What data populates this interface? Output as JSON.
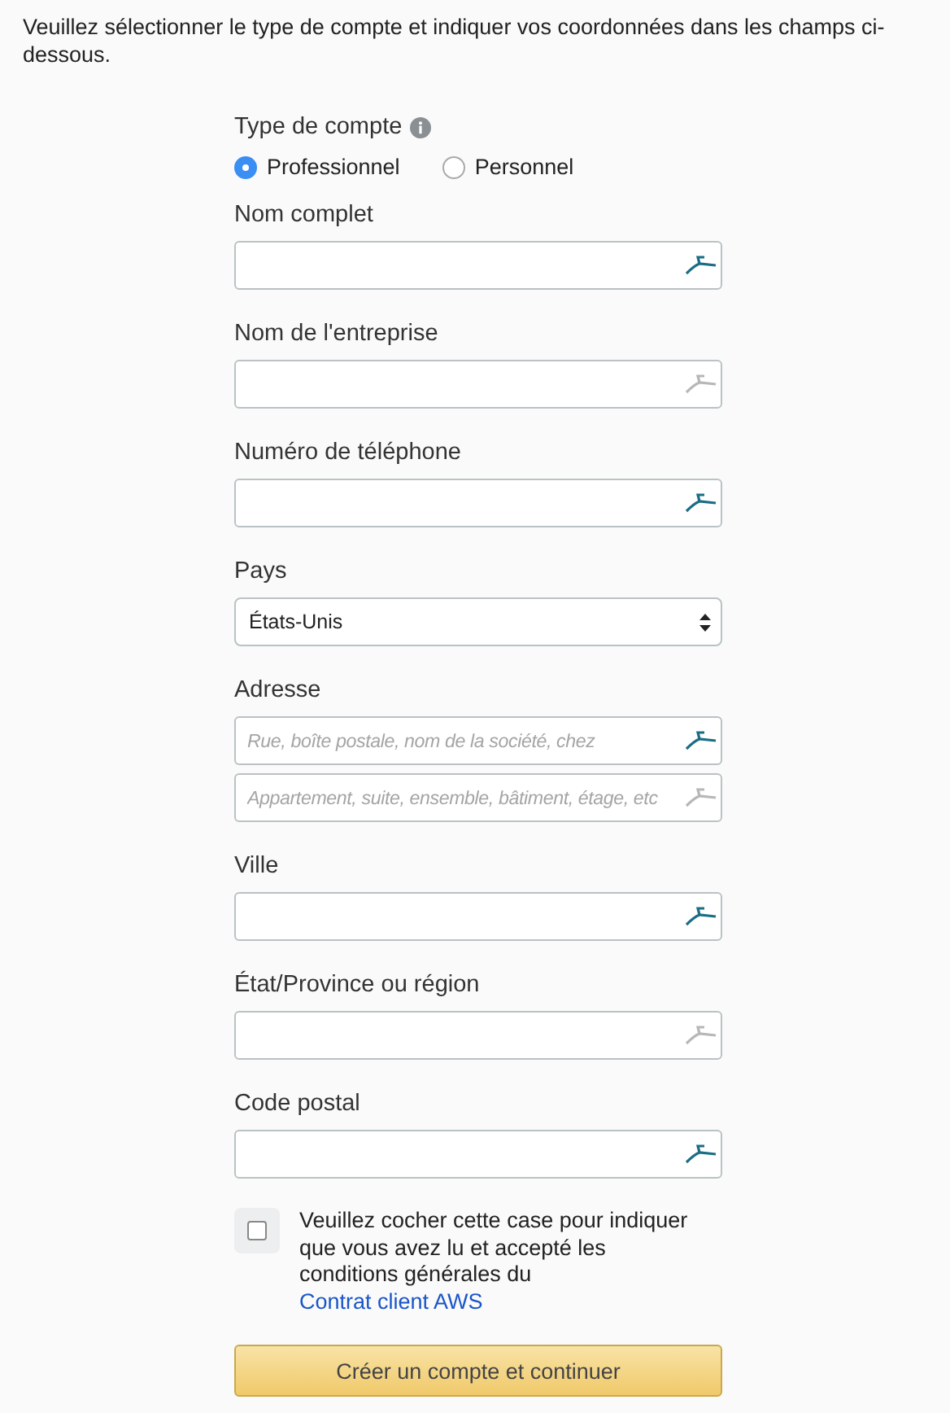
{
  "intro": "Veuillez sélectionner le type de compte et indiquer vos coordonnées dans les champs ci-dessous.",
  "account_type": {
    "label": "Type de compte",
    "options": [
      {
        "label": "Professionnel",
        "selected": true
      },
      {
        "label": "Personnel",
        "selected": false
      }
    ]
  },
  "fields": [
    {
      "kind": "text",
      "label": "Nom complet",
      "inputs": [
        {
          "icon_active": true
        }
      ]
    },
    {
      "kind": "text",
      "label": "Nom de l'entreprise",
      "inputs": [
        {
          "icon_active": false
        }
      ]
    },
    {
      "kind": "text",
      "label": "Numéro de téléphone",
      "inputs": [
        {
          "icon_active": true
        }
      ]
    },
    {
      "kind": "select",
      "label": "Pays",
      "value": "États-Unis"
    },
    {
      "kind": "text",
      "label": "Adresse",
      "inputs": [
        {
          "placeholder": "Rue, boîte postale, nom de la société, chez",
          "icon_active": true
        },
        {
          "placeholder": "Appartement, suite, ensemble, bâtiment, étage, etc",
          "icon_active": false
        }
      ]
    },
    {
      "kind": "text",
      "label": "Ville",
      "inputs": [
        {
          "icon_active": true
        }
      ]
    },
    {
      "kind": "text",
      "label": "État/Province ou région",
      "inputs": [
        {
          "icon_active": false
        }
      ]
    },
    {
      "kind": "text",
      "label": "Code postal",
      "inputs": [
        {
          "icon_active": true
        }
      ]
    }
  ],
  "agreement": {
    "checked": false,
    "text": "Veuillez cocher cette case pour indiquer que vous avez lu et accepté les conditions générales du",
    "link": "Contrat client AWS"
  },
  "submit": "Créer un compte et continuer"
}
